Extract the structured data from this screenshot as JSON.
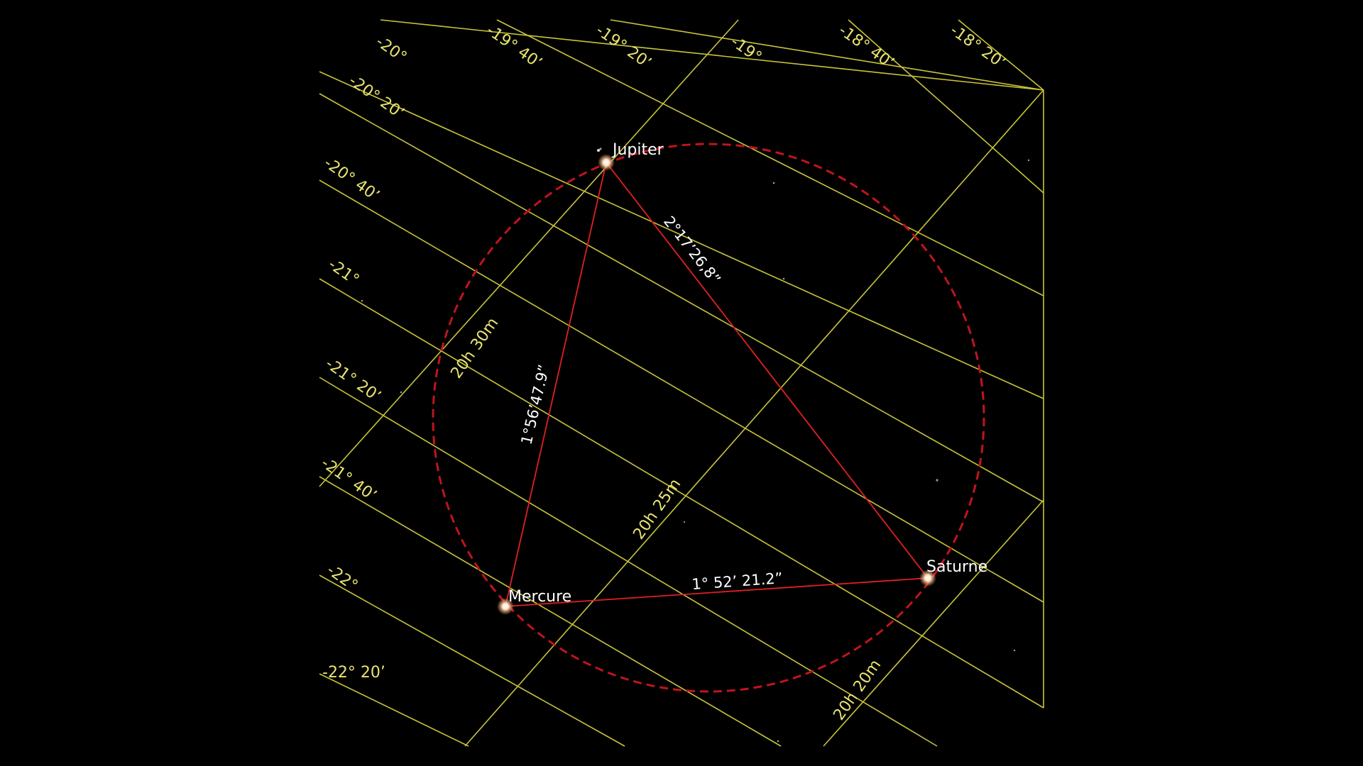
{
  "declination_labels": [
    "-20°",
    "-19° 40’",
    "-19° 20’",
    "-19°",
    "-18° 40’",
    "-18° 20’",
    "-20° 20’",
    "-20° 40’",
    "-21°",
    "-21° 20’",
    "-21° 40’",
    "-22°",
    "-22° 20’"
  ],
  "right_ascension_labels": [
    "20h 30m",
    "20h 25m",
    "20h 20m"
  ],
  "planets": [
    {
      "name": "Jupiter"
    },
    {
      "name": "Mercure"
    },
    {
      "name": "Saturne"
    }
  ],
  "distances": {
    "jupiter_saturne": "2°17’26,8”",
    "jupiter_mercure": "1°56’47.9”",
    "mercure_saturne": "1° 52’ 21.2”"
  },
  "colors": {
    "background": "#000000",
    "grid": "#c8c43a",
    "grid_label": "#e8e470",
    "measure_line": "#e02020",
    "circle": "#c0141e",
    "planet_label": "#ffffff"
  }
}
